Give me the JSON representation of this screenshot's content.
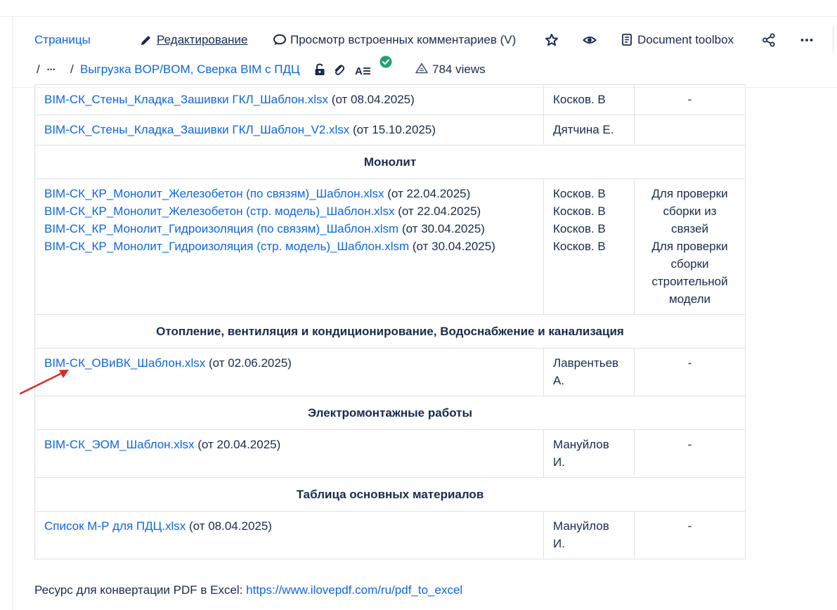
{
  "toolbar": {
    "pages_label": "Страницы",
    "edit_label": "Редактирование",
    "comments_label": "Просмотр встроенных комментариев (V)",
    "toolbox_label": "Document toolbox"
  },
  "breadcrumb": {
    "slash": "/",
    "ellipsis": "•••",
    "sep": "/",
    "page_title": "Выгрузка BOP/BOM, Сверка BIM с ПДЦ",
    "views": "784 views"
  },
  "table": {
    "rows": [
      {
        "type": "data",
        "files": [
          {
            "name": "BIM-СК_Стены_Кладка_Зашивки ГКЛ_Шаблон.xlsx",
            "date": " (от 08.04.2025)"
          }
        ],
        "authors": [
          "Косков. В"
        ],
        "notes": [
          "-"
        ]
      },
      {
        "type": "data",
        "files": [
          {
            "name": "BIM-СК_Стены_Кладка_Зашивки ГКЛ_Шаблон_V2.xlsx",
            "date": " (от 15.10.2025)"
          }
        ],
        "authors": [
          "Дятчина Е."
        ],
        "notes": []
      },
      {
        "type": "section",
        "title": "Монолит"
      },
      {
        "type": "data",
        "files": [
          {
            "name": "BIM-СК_КР_Монолит_Железобетон (по связям)_Шаблон.xlsx",
            "date": " (от 22.04.2025)"
          },
          {
            "name": "BIM-СК_КР_Монолит_Железобетон (стр. модель)_Шаблон.xlsx",
            "date": " (от 22.04.2025)"
          },
          {
            "name": "BIM-СК_КР_Монолит_Гидроизоляция (по связям)_Шаблон.xlsm",
            "date": " (от 30.04.2025)"
          },
          {
            "name": "BIM-СК_КР_Монолит_Гидроизоляция (стр. модель)_Шаблон.xlsm",
            "date": " (от 30.04.2025)"
          }
        ],
        "authors": [
          "Косков. В",
          "Косков. В",
          "Косков. В",
          "Косков. В"
        ],
        "notes": [
          "Для проверки",
          "сборки из",
          "связей",
          "Для проверки",
          "сборки",
          "строительной",
          "модели"
        ]
      },
      {
        "type": "section",
        "title": "Отопление, вентиляция и кондиционирование, Водоснабжение и канализация"
      },
      {
        "type": "data",
        "files": [
          {
            "name": "BIM-СК_ОВиВК_Шаблон.xlsx",
            "date": " (от 02.06.2025)"
          }
        ],
        "authors": [
          "Лаврентьев",
          "А."
        ],
        "notes": [
          "-"
        ]
      },
      {
        "type": "section",
        "title": "Электромонтажные работы"
      },
      {
        "type": "data",
        "files": [
          {
            "name": "BIM-СК_ЭОМ_Шаблон.xlsx",
            "date": " (от 20.04.2025)"
          }
        ],
        "authors": [
          "Мануйлов",
          "И."
        ],
        "notes": [
          "-"
        ]
      },
      {
        "type": "section",
        "title": "Таблица основных материалов"
      },
      {
        "type": "data",
        "files": [
          {
            "name": "Список М-Р для ПДЦ.xlsx",
            "date": " (от 08.04.2025)"
          }
        ],
        "authors": [
          "Мануйлов",
          "И."
        ],
        "notes": [
          "-"
        ]
      }
    ]
  },
  "footer": {
    "label": "Ресурс для конвертации PDF в Excel: ",
    "link": "https://www.ilovepdf.com/ru/pdf_to_excel"
  },
  "colors": {
    "link": "#0c66e4",
    "text": "#172b4d",
    "border": "#dfe1e6",
    "status_green": "#22a06b",
    "arrow": "#d92b2b"
  },
  "icons": {
    "edit": "pencil-icon",
    "comments": "speech-bubble-icon",
    "star": "star-icon",
    "watch": "eye-icon",
    "toolbox": "document-icon",
    "share": "share-icon",
    "more": "more-horizontal-icon",
    "restrictions": "unlock-icon",
    "attachments": "paperclip-icon",
    "text_format": "text-format-icon",
    "status": "check-circle-icon",
    "analytics": "analytics-triangle-icon"
  }
}
